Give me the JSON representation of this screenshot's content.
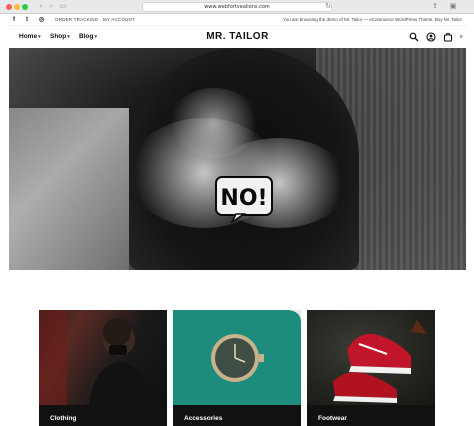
{
  "browser": {
    "url": "www.webfortvealions.com"
  },
  "topbar": {
    "social_icons": [
      "facebook-icon",
      "twitter-icon",
      "instagram-icon"
    ],
    "links": [
      "ORDER TRACKING",
      "MY ACCOUNT"
    ],
    "note": "You are browsing the demo of Mr. Tailor — eCommerce WordPress Theme. Buy Mr. Tailor"
  },
  "header": {
    "nav": [
      {
        "label": "Home"
      },
      {
        "label": "Shop"
      },
      {
        "label": "Blog"
      }
    ],
    "logo": "MR. TAILOR",
    "cart_count": "0",
    "icons": [
      "search-icon",
      "user-icon",
      "cart-icon"
    ]
  },
  "hero": {
    "sign_text": "NO!"
  },
  "categories": [
    {
      "label": "Clothing"
    },
    {
      "label": "Accessories"
    },
    {
      "label": "Footwear"
    }
  ],
  "colors": {
    "accent_dark": "#111111",
    "accessories_bg": "#1e8c7c",
    "footwear_shoe": "#c0152a"
  }
}
